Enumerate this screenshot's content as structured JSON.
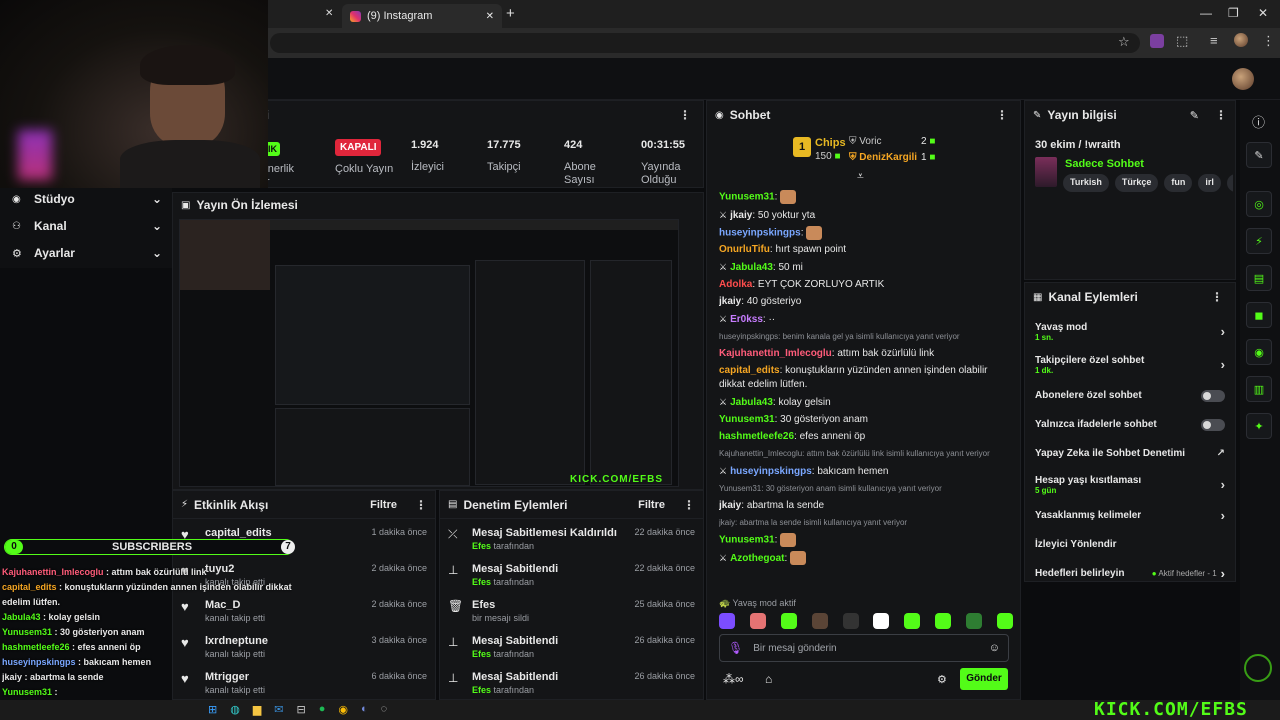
{
  "browser": {
    "tab_instagram": "(9) Instagram",
    "new_tab": "+",
    "close": "✕"
  },
  "stats": {
    "left_partial_label": "Partnerlik Durumu",
    "left_partial_short": "rtnerlik\nlir",
    "acik_short": "IK",
    "kapali_btn": "KAPALI",
    "multistream_label": "Çoklu Yayın",
    "viewers_value": "1.924",
    "viewers_label": "İzleyici",
    "followers_value": "17.775",
    "followers_label": "Takipçi",
    "subs_value": "424",
    "subs_label": "Abone Sayısı",
    "uptime_value": "00:31:55",
    "uptime_label": "Yayında Olduğu"
  },
  "left_nav": {
    "studio": "Stüdyo",
    "channel": "Kanal",
    "settings": "Ayarlar"
  },
  "preview": {
    "title": "Yayın Ön İzlemesi",
    "watermark": "KICK.COM/EFBS"
  },
  "activity": {
    "title": "Etkinlik Akışı",
    "filter": "Filtre",
    "items": [
      {
        "user": "capital_edits",
        "action": "kanalı takip etti",
        "time": "1 dakika önce"
      },
      {
        "user": "tuyu2",
        "action": "kanalı takip etti",
        "time": "2 dakika önce"
      },
      {
        "user": "Mac_D",
        "action": "kanalı takip etti",
        "time": "2 dakika önce"
      },
      {
        "user": "lxrdneptune",
        "action": "kanalı takip etti",
        "time": "3 dakika önce"
      },
      {
        "user": "Mtrigger",
        "action": "kanalı takip etti",
        "time": "6 dakika önce"
      }
    ]
  },
  "moderation": {
    "title": "Denetim Eylemleri",
    "filter": "Filtre",
    "items": [
      {
        "action": "Mesaj Sabitlemesi Kaldırıldı",
        "by_user": "Efes",
        "by_suffix": "tarafından",
        "time": "22 dakika önce"
      },
      {
        "action": "Mesaj Sabitlendi",
        "by_user": "Efes",
        "by_suffix": "tarafından",
        "time": "22 dakika önce"
      },
      {
        "action": "Efes",
        "by_user": "",
        "by_suffix": "bir mesajı sildi",
        "time": "25 dakika önce"
      },
      {
        "action": "Mesaj Sabitlendi",
        "by_user": "Efes",
        "by_suffix": "tarafından",
        "time": "26 dakika önce"
      },
      {
        "action": "Mesaj Sabitlendi",
        "by_user": "Efes",
        "by_suffix": "tarafından",
        "time": "26 dakika önce"
      }
    ]
  },
  "chat": {
    "title": "Sohbet",
    "leaderboard": {
      "chips_label": "Chips",
      "chips_value": "150",
      "first_rank": "1",
      "voric": "Voric",
      "voric_count": "2",
      "deniz": "DenizKargili",
      "deniz_count": "1"
    },
    "messages": [
      {
        "user": "Yunusem31",
        "color": "#53fc18",
        "text": ""
      },
      {
        "user": "jkaiy",
        "color": "#e8e8e8",
        "text": "50 yoktur yta"
      },
      {
        "user": "huseyinpskingps",
        "color": "#7aa7ff",
        "text": ""
      },
      {
        "user": "OnurluTifu",
        "color": "#f5a623",
        "text": "hırt spawn point"
      },
      {
        "user": "Jabula43",
        "color": "#53fc18",
        "text": "50 mi"
      },
      {
        "user": "Adolka",
        "color": "#ff4d4d",
        "text": "EYT ÇOK ZORLUYO ARTIK"
      },
      {
        "user": "jkaiy",
        "color": "#e8e8e8",
        "text": "40 gösteriyo"
      },
      {
        "user": "Er0kss",
        "color": "#c77dff",
        "text": "··"
      },
      {
        "reply": "huseyinpskingps: benim kanala gel ya isimli kullanıcıya yanıt veriyor",
        "user": "Kajuhanettin_Imlecoglu",
        "color": "#ff5c7a",
        "text": "attım bak özürlülü link"
      },
      {
        "user": "capital_edits",
        "color": "#f5a623",
        "text": "konuştukların yüzünden annen işinden olabilir dikkat edelim lütfen."
      },
      {
        "user": "Jabula43",
        "color": "#53fc18",
        "text": "kolay gelsin"
      },
      {
        "user": "Yunusem31",
        "color": "#53fc18",
        "text": "30 gösteriyon anam"
      },
      {
        "user": "hashmetleefe26",
        "color": "#53fc18",
        "text": "efes anneni öp"
      },
      {
        "reply": "Kajuhanettin_Imlecoglu: attım bak özürlülü link isimli kullanıcıya yanıt veriyor",
        "user": "huseyinpskingps",
        "color": "#7aa7ff",
        "text": "bakıcam hemen"
      },
      {
        "reply": "Yunusem31: 30 gösteriyon anam isimli kullanıcıya yanıt veriyor",
        "user": "jkaiy",
        "color": "#e8e8e8",
        "text": "abartma la sende"
      },
      {
        "reply": "jkaiy: abartma la sende isimli kullanıcıya yanıt veriyor",
        "user": "Yunusem31",
        "color": "#53fc18",
        "text": ""
      },
      {
        "user": "Azothegoat",
        "color": "#53fc18",
        "text": ""
      }
    ],
    "slow_mode_notice": "Yavaş mod aktif",
    "input_placeholder": "Bir mesaj gönderin",
    "send_button": "Gönder"
  },
  "stream_info": {
    "title": "Yayın bilgisi",
    "stream_title": "30 ekim / !wraith",
    "category": "Sadece Sohbet",
    "tags": [
      "Turkish",
      "Türkçe",
      "fun",
      "irl",
      "spe"
    ]
  },
  "channel_actions": {
    "title": "Kanal Eylemleri",
    "items": [
      {
        "label": "Yavaş mod",
        "sub": "1 sn.",
        "control": "chevron"
      },
      {
        "label": "Takipçilere özel sohbet",
        "sub": "1 dk.",
        "control": "chevron"
      },
      {
        "label": "Abonelere özel sohbet",
        "sub": "",
        "control": "toggle"
      },
      {
        "label": "Yalnızca ifadelerle sohbet",
        "sub": "",
        "control": "toggle"
      },
      {
        "label": "Yapay Zeka ile Sohbet Denetimi",
        "sub": "",
        "control": "external"
      },
      {
        "label": "Hesap yaşı kısıtlaması",
        "sub": "5 gün",
        "control": "chevron"
      },
      {
        "label": "Yasaklanmış kelimeler",
        "sub": "",
        "control": "chevron"
      },
      {
        "label": "İzleyici Yönlendir",
        "sub": "",
        "control": "none"
      },
      {
        "label": "Hedefleri belirleyin",
        "sub": "",
        "control": "goals"
      }
    ],
    "goals_badge": "Aktif hedefler - 1"
  },
  "overlay": {
    "subs_count": "0",
    "subs_label": "SUBSCRIBERS",
    "subs_goal": "7",
    "bottom_watermark": "KICK.COM/EFBS",
    "chat_lines": [
      {
        "user": "Kajuhanettin_Imlecoglu",
        "color": "#ff5c7a",
        "text": "attım bak özürlülü link"
      },
      {
        "user": "capital_edits",
        "color": "#f5a623",
        "text": "konuştukların yüzünden annen işinden olabilir dikkat edelim lütfen."
      },
      {
        "user": "Jabula43",
        "color": "#53fc18",
        "text": "kolay gelsin"
      },
      {
        "user": "Yunusem31",
        "color": "#53fc18",
        "text": "30 gösteriyon anam"
      },
      {
        "user": "hashmetleefe26",
        "color": "#53fc18",
        "text": "efes anneni öp"
      },
      {
        "user": "huseyinpskingps",
        "color": "#7aa7ff",
        "text": "bakıcam hemen"
      },
      {
        "user": "jkaiy",
        "color": "#e8e8e8",
        "text": "abartma la sende"
      },
      {
        "user": "Yunusem31",
        "color": "#53fc18",
        "text": ""
      }
    ]
  }
}
